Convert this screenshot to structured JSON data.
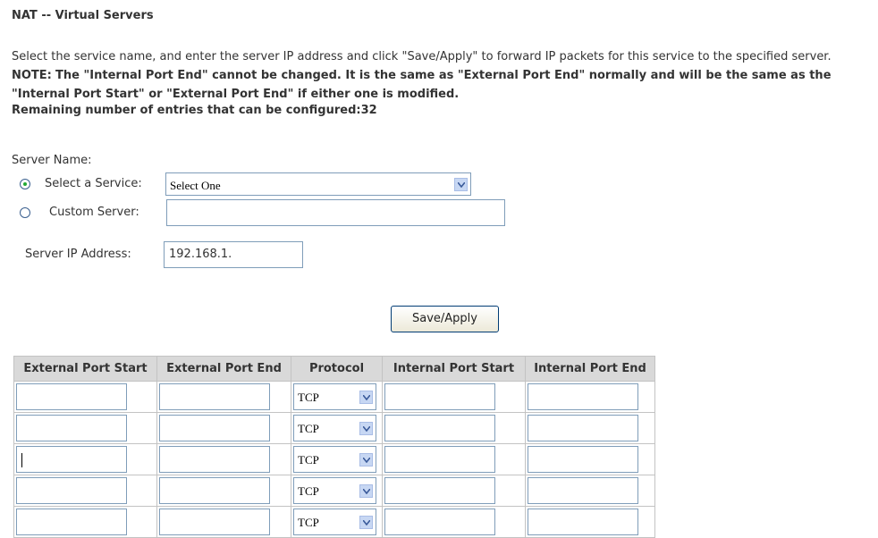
{
  "page": {
    "title": "NAT -- Virtual Servers",
    "description_plain": "Select the service name, and enter the server IP address and click \"Save/Apply\" to forward IP packets for this service to the specified server.",
    "description_note_label": "NOTE:",
    "description_note": "The \"Internal Port End\" cannot be changed. It is the same as \"External Port End\" normally and will be the same as the \"Internal Port Start\" or \"External Port End\" if either one is modified.",
    "remaining": "Remaining number of entries that can be configured:32"
  },
  "form": {
    "server_name_label": "Server Name:",
    "select_service_label": "Select a Service:",
    "select_service_value": "Select One",
    "custom_server_label": "Custom Server:",
    "custom_server_value": "",
    "server_ip_label": "Server IP Address:",
    "server_ip_value": "192.168.1.",
    "selected_option": "select_service"
  },
  "actions": {
    "save_apply_label": "Save/Apply"
  },
  "port_table": {
    "headers": [
      "External Port Start",
      "External Port End",
      "Protocol",
      "Internal Port Start",
      "Internal Port End"
    ],
    "rows": [
      {
        "ext_start": "",
        "ext_end": "",
        "protocol": "TCP",
        "int_start": "",
        "int_end": ""
      },
      {
        "ext_start": "",
        "ext_end": "",
        "protocol": "TCP",
        "int_start": "",
        "int_end": ""
      },
      {
        "ext_start": "",
        "ext_end": "",
        "protocol": "TCP",
        "int_start": "",
        "int_end": ""
      },
      {
        "ext_start": "",
        "ext_end": "",
        "protocol": "TCP",
        "int_start": "",
        "int_end": ""
      },
      {
        "ext_start": "",
        "ext_end": "",
        "protocol": "TCP",
        "int_start": "",
        "int_end": ""
      }
    ]
  },
  "colors": {
    "header_bg": "#d9d9d9",
    "input_border": "#7f9db9",
    "radio_selected": "#22aa33"
  }
}
